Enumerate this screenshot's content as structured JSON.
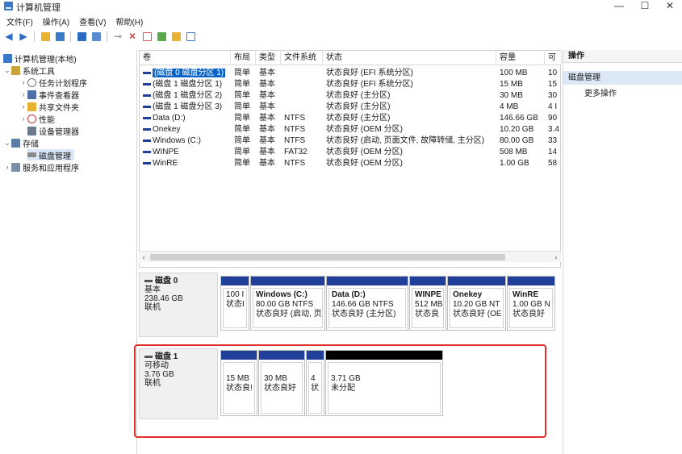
{
  "window": {
    "title": "计算机管理",
    "minimize": "—",
    "maximize": "☐",
    "close": "✕"
  },
  "menu": [
    "文件(F)",
    "操作(A)",
    "查看(V)",
    "帮助(H)"
  ],
  "tree": {
    "root": "计算机管理(本地)",
    "system_tools": "系统工具",
    "task_scheduler": "任务计划程序",
    "event_viewer": "事件查看器",
    "shared_folders": "共享文件夹",
    "performance": "性能",
    "device_manager": "设备管理器",
    "storage": "存储",
    "disk_management": "磁盘管理",
    "services_apps": "服务和应用程序"
  },
  "table": {
    "headers": [
      "卷",
      "布局",
      "类型",
      "文件系统",
      "状态",
      "容量",
      "可"
    ],
    "rows": [
      [
        "(磁盘 0 磁盘分区 1)",
        "简单",
        "基本",
        "",
        "状态良好 (EFI 系统分区)",
        "100 MB",
        "10"
      ],
      [
        "(磁盘 1 磁盘分区 1)",
        "简单",
        "基本",
        "",
        "状态良好 (EFI 系统分区)",
        "15 MB",
        "15"
      ],
      [
        "(磁盘 1 磁盘分区 2)",
        "简单",
        "基本",
        "",
        "状态良好 (主分区)",
        "30 MB",
        "30"
      ],
      [
        "(磁盘 1 磁盘分区 3)",
        "简单",
        "基本",
        "",
        "状态良好 (主分区)",
        "4 MB",
        "4 I"
      ],
      [
        "Data (D:)",
        "简单",
        "基本",
        "NTFS",
        "状态良好 (主分区)",
        "146.66 GB",
        "90"
      ],
      [
        "Onekey",
        "简单",
        "基本",
        "NTFS",
        "状态良好 (OEM 分区)",
        "10.20 GB",
        "3.4"
      ],
      [
        "Windows (C:)",
        "简单",
        "基本",
        "NTFS",
        "状态良好 (启动, 页面文件, 故障转储, 主分区)",
        "80.00 GB",
        "33"
      ],
      [
        "WINPE",
        "简单",
        "基本",
        "FAT32",
        "状态良好 (OEM 分区)",
        "508 MB",
        "14"
      ],
      [
        "WinRE",
        "简单",
        "基本",
        "NTFS",
        "状态良好 (OEM 分区)",
        "1.00 GB",
        "58"
      ]
    ]
  },
  "disk0": {
    "name": "磁盘 0",
    "type": "基本",
    "size": "238.46 GB",
    "status": "联机",
    "parts": [
      {
        "name": "",
        "size": "100 I",
        "status": "状态I"
      },
      {
        "name": "Windows (C:)",
        "size": "80.00 GB NTFS",
        "status": "状态良好 (启动, 页"
      },
      {
        "name": "Data (D:)",
        "size": "146.66 GB NTFS",
        "status": "状态良好 (主分区)"
      },
      {
        "name": "WINPE",
        "size": "512 MB",
        "status": "状态良"
      },
      {
        "name": "Onekey",
        "size": "10.20 GB NT",
        "status": "状态良好 (OE"
      },
      {
        "name": "WinRE",
        "size": "1.00 GB N",
        "status": "状态良好"
      }
    ]
  },
  "disk1": {
    "name": "磁盘 1",
    "type": "可移动",
    "size": "3.76 GB",
    "status": "联机",
    "parts": [
      {
        "size": "15 MB",
        "status": "状态良!"
      },
      {
        "size": "30 MB",
        "status": "状态良好"
      },
      {
        "size": "4",
        "status": "状"
      },
      {
        "size": "3.71 GB",
        "status": "未分配"
      }
    ]
  },
  "actions": {
    "header": "操作",
    "section": "磁盘管理",
    "more": "更多操作"
  },
  "colors": {
    "primary_partition": "#1f3f99",
    "unallocated": "#000000",
    "highlight": "#e0302a"
  }
}
